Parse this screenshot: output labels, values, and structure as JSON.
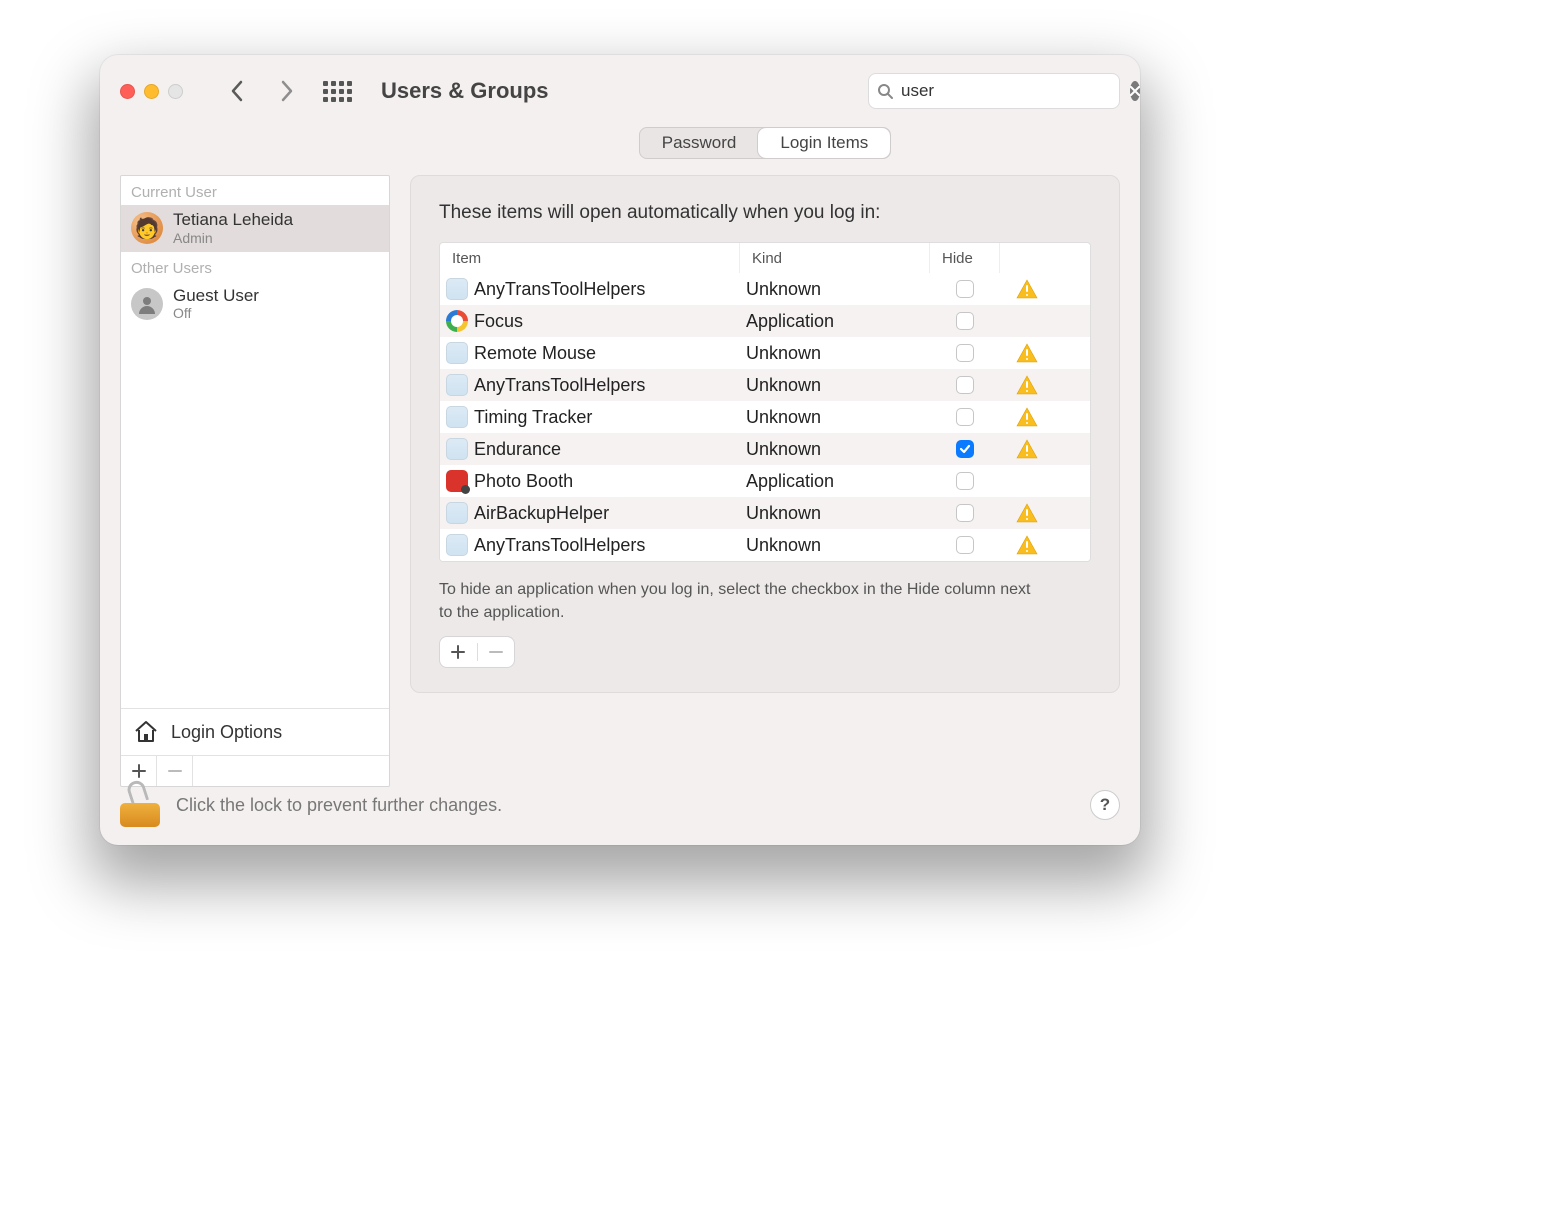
{
  "window": {
    "title": "Users & Groups"
  },
  "search": {
    "value": "user"
  },
  "sidebar": {
    "current_label": "Current User",
    "other_label": "Other Users",
    "current_user": {
      "name": "Tetiana Leheida",
      "role": "Admin"
    },
    "other_users": [
      {
        "name": "Guest User",
        "role": "Off"
      }
    ],
    "login_options_label": "Login Options"
  },
  "tabs": {
    "password": "Password",
    "login_items": "Login Items"
  },
  "panel": {
    "intro": "These items will open automatically when you log in:",
    "columns": {
      "item": "Item",
      "kind": "Kind",
      "hide": "Hide"
    },
    "rows": [
      {
        "name": "AnyTransToolHelpers",
        "kind": "Unknown",
        "icon": "placeholder",
        "hide": false,
        "warn": true
      },
      {
        "name": "Focus",
        "kind": "Application",
        "icon": "focus",
        "hide": false,
        "warn": false
      },
      {
        "name": "Remote Mouse",
        "kind": "Unknown",
        "icon": "placeholder",
        "hide": false,
        "warn": true
      },
      {
        "name": "AnyTransToolHelpers",
        "kind": "Unknown",
        "icon": "placeholder",
        "hide": false,
        "warn": true
      },
      {
        "name": "Timing Tracker",
        "kind": "Unknown",
        "icon": "placeholder",
        "hide": false,
        "warn": true
      },
      {
        "name": "Endurance",
        "kind": "Unknown",
        "icon": "placeholder",
        "hide": true,
        "warn": true
      },
      {
        "name": "Photo Booth",
        "kind": "Application",
        "icon": "pb",
        "hide": false,
        "warn": false
      },
      {
        "name": "AirBackupHelper",
        "kind": "Unknown",
        "icon": "placeholder",
        "hide": false,
        "warn": true
      },
      {
        "name": "AnyTransToolHelpers",
        "kind": "Unknown",
        "icon": "placeholder",
        "hide": false,
        "warn": true
      }
    ],
    "hint": "To hide an application when you log in, select the checkbox in the Hide column next to the application."
  },
  "footer": {
    "text": "Click the lock to prevent further changes."
  }
}
